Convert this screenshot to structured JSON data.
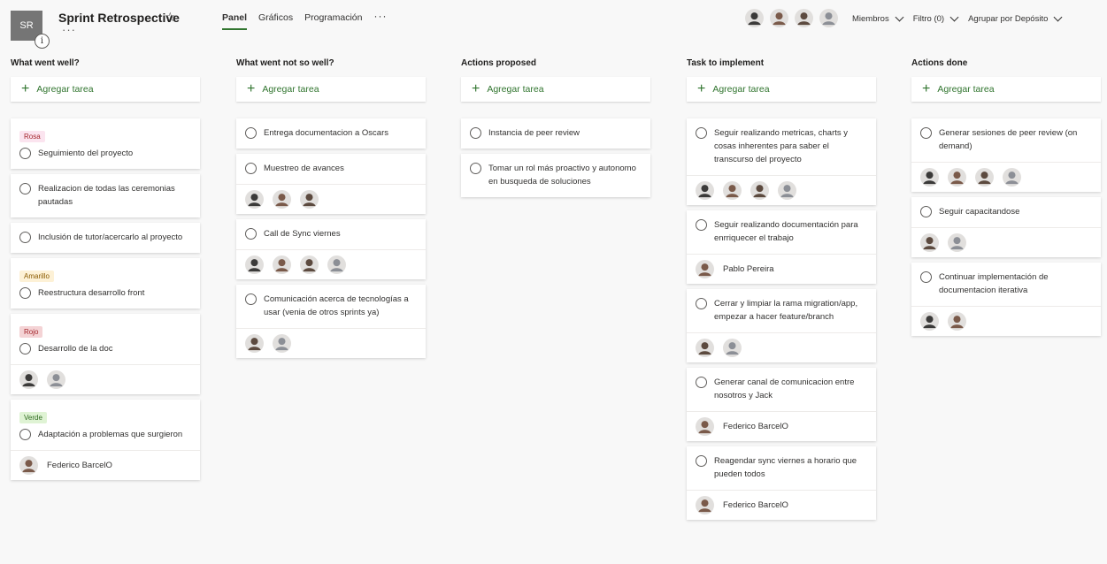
{
  "header": {
    "plan_initials": "SR",
    "info_glyph": "i",
    "title": "Sprint Retrospective",
    "star_icon": "☆",
    "more_glyph": "···",
    "tabs": [
      {
        "label": "Panel",
        "active": true
      },
      {
        "label": "Gráficos",
        "active": false
      },
      {
        "label": "Programación",
        "active": false
      }
    ],
    "tabs_more": "···",
    "members_label": "Miembros",
    "filter_label": "Filtro (0)",
    "group_label": "Agrupar por Depósito"
  },
  "add_task_label": "Agregar tarea",
  "colors": {
    "accent": "#31752f",
    "avatar_palette": [
      "#3b3a39",
      "#7a5a4a",
      "#5c4a3f",
      "#8c8f96"
    ]
  },
  "columns": [
    {
      "title": "What went well?",
      "cards": [
        {
          "label": "Rosa",
          "label_bg": "#fbe4ef",
          "label_fg": "#a4262c",
          "text": "Seguimiento del proyecto",
          "avatars": [],
          "assignee": ""
        },
        {
          "label": "",
          "text": "Realizacion de todas las ceremonias pautadas",
          "avatars": [],
          "assignee": ""
        },
        {
          "label": "",
          "text": "Inclusión de tutor/acercarlo al proyecto",
          "avatars": [],
          "assignee": ""
        },
        {
          "label": "Amarillo",
          "label_bg": "#fdf1d6",
          "label_fg": "#8a5a00",
          "text": "Reestructura desarrollo front",
          "avatars": [],
          "assignee": ""
        },
        {
          "label": "Rojo",
          "label_bg": "#f4d3d5",
          "label_fg": "#a4262c",
          "text": "Desarrollo de la doc",
          "avatars": [
            0,
            3
          ],
          "assignee": ""
        },
        {
          "label": "Verde",
          "label_bg": "#dff3d4",
          "label_fg": "#2e6b1f",
          "text": "Adaptación a problemas que surgieron",
          "avatars": [],
          "assignee": "Federico BarcelO"
        }
      ]
    },
    {
      "title": "What went not so well?",
      "cards": [
        {
          "label": "",
          "text": "Entrega documentacion a Oscars",
          "avatars": [],
          "assignee": ""
        },
        {
          "label": "",
          "text": "Muestreo de avances",
          "avatars": [
            0,
            1,
            2
          ],
          "assignee": ""
        },
        {
          "label": "",
          "text": "Call de Sync viernes",
          "avatars": [
            0,
            1,
            2,
            3
          ],
          "assignee": ""
        },
        {
          "label": "",
          "text": "Comunicación acerca de tecnologías a usar (venia de otros sprints ya)",
          "avatars": [
            2,
            3
          ],
          "assignee": ""
        }
      ]
    },
    {
      "title": "Actions proposed",
      "cards": [
        {
          "label": "",
          "text": "Instancia de peer review",
          "avatars": [],
          "assignee": ""
        },
        {
          "label": "",
          "text": "Tomar un rol más proactivo y autonomo en busqueda de soluciones",
          "avatars": [],
          "assignee": ""
        }
      ]
    },
    {
      "title": "Task to implement",
      "cards": [
        {
          "label": "",
          "text": "Seguir realizando metricas, charts y cosas inherentes para saber el transcurso del proyecto",
          "avatars": [
            0,
            1,
            2,
            3
          ],
          "assignee": ""
        },
        {
          "label": "",
          "text": "Seguir realizando documentación para enrriquecer el trabajo",
          "avatars": [],
          "assignee": "Pablo Pereira"
        },
        {
          "label": "",
          "text": "Cerrar y limpiar la rama migration/app, empezar a hacer feature/branch",
          "avatars": [
            2,
            3
          ],
          "assignee": ""
        },
        {
          "label": "",
          "text": "Generar canal de comunicacion entre nosotros y Jack",
          "avatars": [],
          "assignee": "Federico BarcelO"
        },
        {
          "label": "",
          "text": "Reagendar sync viernes a horario que pueden todos",
          "avatars": [],
          "assignee": "Federico BarcelO"
        }
      ]
    },
    {
      "title": "Actions done",
      "cards": [
        {
          "label": "",
          "text": "Generar sesiones de peer review (on demand)",
          "avatars": [
            0,
            1,
            2,
            3
          ],
          "assignee": ""
        },
        {
          "label": "",
          "text": "Seguir capacitandose",
          "avatars": [
            2,
            3
          ],
          "assignee": ""
        },
        {
          "label": "",
          "text": "Continuar implementación de documentacion iterativa",
          "avatars": [
            0,
            1
          ],
          "assignee": ""
        }
      ]
    }
  ]
}
